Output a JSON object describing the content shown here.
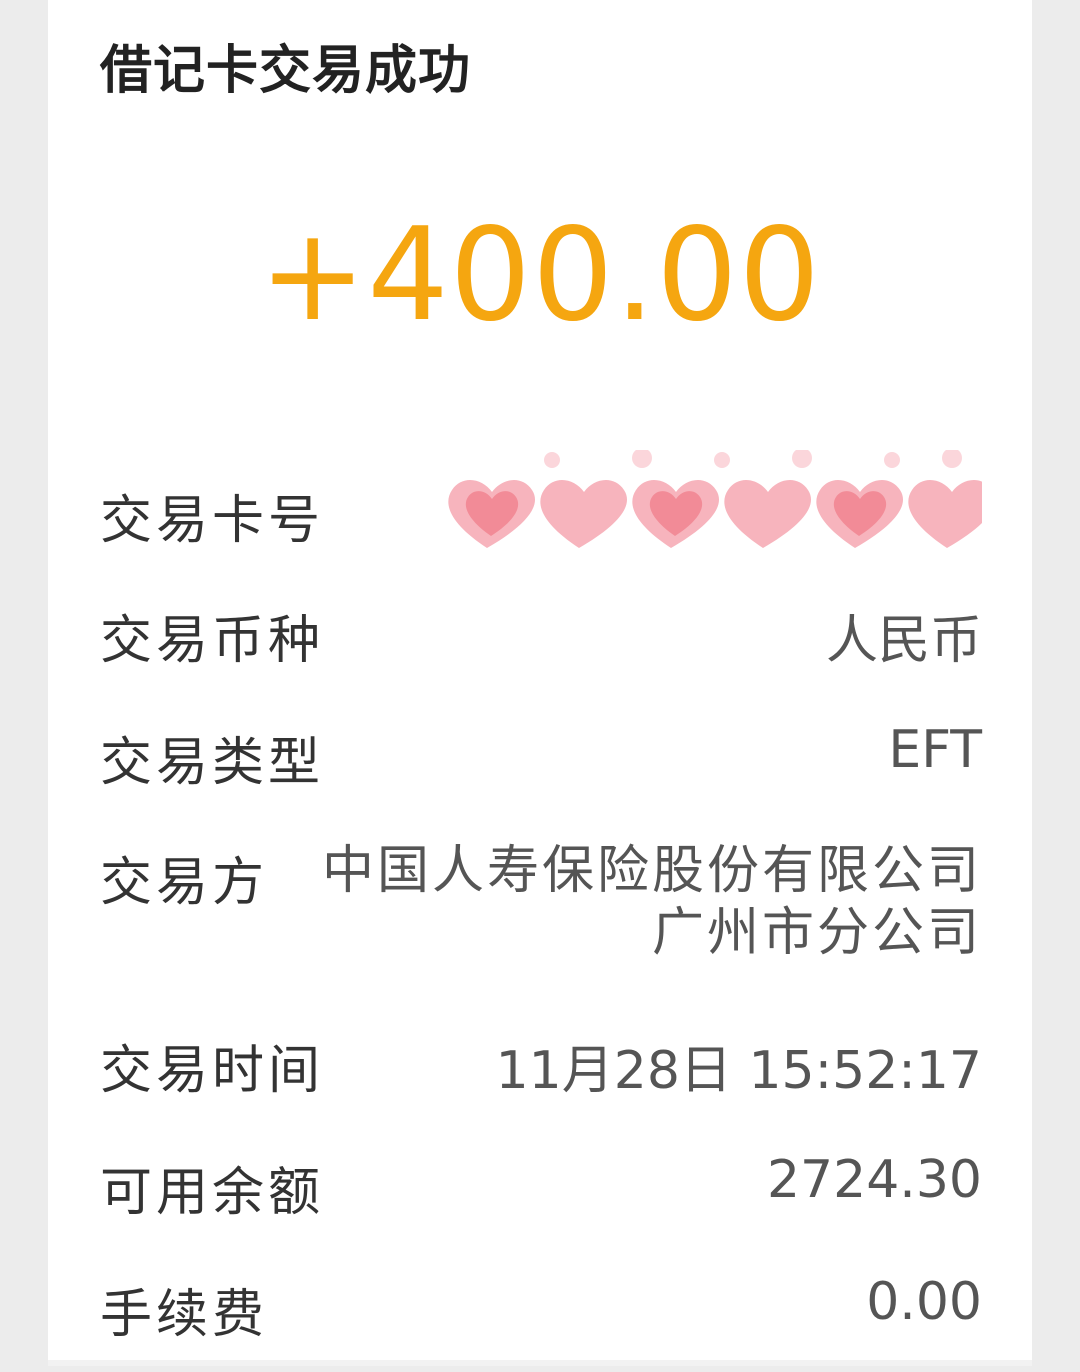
{
  "header": {
    "title": "借记卡交易成功"
  },
  "amount": "+400.00",
  "details": {
    "card_number_label": "交易卡号",
    "currency_label": "交易币种",
    "currency_value": "人民币",
    "type_label": "交易类型",
    "type_value": "EFT",
    "counterparty_label": "交易方",
    "counterparty_line1": "中国人寿保险股份有限公司",
    "counterparty_line2": "广州市分公司",
    "time_label": "交易时间",
    "time_value": "11月28日 15:52:17",
    "balance_label": "可用余额",
    "balance_value": "2724.30",
    "fee_label": "手续费",
    "fee_value": "0.00"
  },
  "colors": {
    "amount": "#f5a610",
    "heart": "#f7a8b2",
    "heart_inner": "#f28591"
  },
  "icons": {
    "card_number_mask": "heart-sticker-icon"
  }
}
